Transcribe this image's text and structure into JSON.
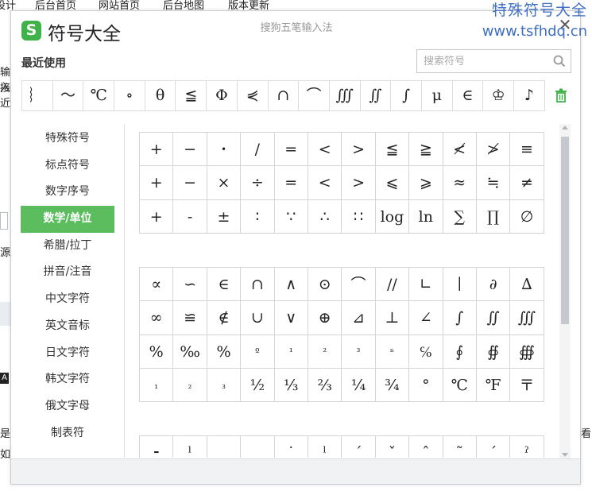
{
  "background": {
    "nav_items": [
      "设计",
      "后台首页",
      "网站首页",
      "后台地图",
      "版本更新"
    ],
    "left_fragments": [
      "输入",
      "接近",
      "源",
      "是",
      "如"
    ],
    "right_fragments": [
      "看"
    ],
    "badge_letter": "A"
  },
  "watermark": {
    "line1": "特殊符号大全",
    "line2": "www.tsfhdq.cn"
  },
  "dialog": {
    "app_title": "符号大全",
    "logo_letter": "S",
    "subtitle": "搜狗五笔输入法",
    "close_glyph": "✕",
    "recent_label": "最近使用",
    "search_placeholder": "搜索符号",
    "recent_symbols": [
      "︴",
      "～",
      "℃",
      "∘",
      "θ",
      "≦",
      "Φ",
      "⋞",
      "∩",
      "⌒",
      "∭",
      "∬",
      "∫",
      "μ",
      "∈",
      "♔",
      "♪"
    ],
    "categories": [
      "特殊符号",
      "标点符号",
      "数字序号",
      "数学/单位",
      "希腊/拉丁",
      "拼音/注音",
      "中文字符",
      "英文音标",
      "日文字符",
      "韩文字符",
      "俄文字母",
      "制表符"
    ],
    "active_category": "数学/单位",
    "math_block_1": [
      "+",
      "−",
      "•",
      "/",
      "=",
      "<",
      ">",
      "≦",
      "≧",
      "≮",
      "≯",
      "≡",
      "+",
      "−",
      "×",
      "÷",
      "=",
      "<",
      ">",
      "⩽",
      "⩾",
      "≈",
      "≒",
      "≠",
      "+",
      "-",
      "±",
      "∶",
      "∵",
      "∴",
      "∷",
      "log",
      "ln",
      "∑",
      "∏",
      "∅"
    ],
    "math_block_2": [
      "∝",
      "∽",
      "∈",
      "∩",
      "∧",
      "⊙",
      "⌒",
      "//",
      "∟",
      "∣",
      "∂",
      "∆",
      "∞",
      "≌",
      "∉",
      "∪",
      "∨",
      "⊕",
      "⊿",
      "⊥",
      "∠",
      "∫",
      "∬",
      "∭",
      "%",
      "‰",
      "%",
      "º",
      "¹",
      "²",
      "³",
      "ⁿ",
      "℅",
      "∮",
      "∯",
      "∰",
      "₁",
      "₂",
      "₃",
      "½",
      "⅓",
      "⅔",
      "¼",
      "¾",
      "°",
      "℃",
      "℉",
      "〒"
    ],
    "math_block_3_partial": [
      "⁃",
      "ˡ",
      "¸",
      "¸",
      "˙",
      "ˡ",
      "ˊ",
      "ˇ",
      "ˆ",
      "˜",
      "ˊ",
      "ˀ"
    ]
  },
  "colors": {
    "accent": "#5cbd5f",
    "logo": "#3fb24a",
    "watermark": "#3f6fc4",
    "trash": "#3fb24a"
  }
}
